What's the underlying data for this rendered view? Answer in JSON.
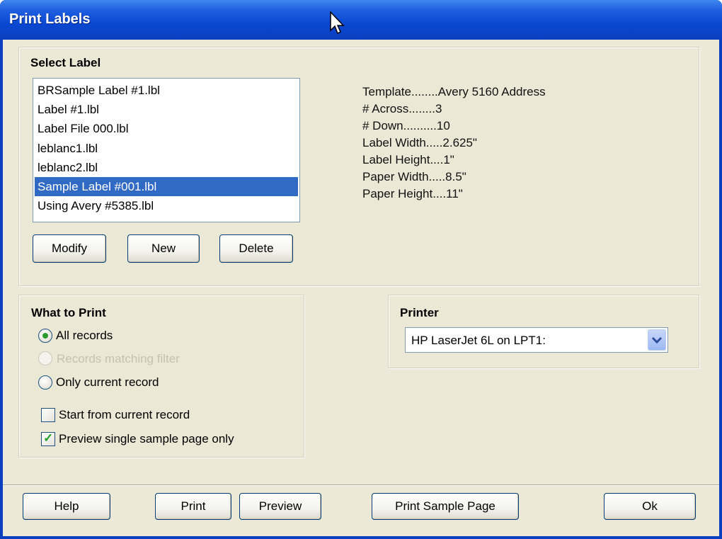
{
  "window": {
    "title": "Print Labels"
  },
  "select_label": {
    "title": "Select Label",
    "items": [
      {
        "label": "BRSample Label #1.lbl",
        "selected": false
      },
      {
        "label": "Label #1.lbl",
        "selected": false
      },
      {
        "label": "Label File 000.lbl",
        "selected": false
      },
      {
        "label": "leblanc1.lbl",
        "selected": false
      },
      {
        "label": "leblanc2.lbl",
        "selected": false
      },
      {
        "label": "Sample Label #001.lbl",
        "selected": true
      },
      {
        "label": "Using Avery #5385.lbl",
        "selected": false
      }
    ],
    "buttons": {
      "modify": "Modify",
      "new": "New",
      "delete": "Delete"
    }
  },
  "template_info": [
    "Template........Avery 5160  Address",
    "# Across........3",
    "# Down..........10",
    "Label Width.....2.625\"",
    "Label Height....1\"",
    "Paper Width.....8.5\"",
    "Paper Height....11\""
  ],
  "what_to_print": {
    "title": "What to Print",
    "all_records": "All records",
    "records_matching_filter": "Records matching filter",
    "only_current_record": "Only current record",
    "selected_option": "all_records",
    "start_from_current": {
      "label": "Start from current record",
      "checked": false
    },
    "preview_single": {
      "label": "Preview single sample page only",
      "checked": true
    }
  },
  "printer": {
    "title": "Printer",
    "selected": "HP LaserJet 6L on LPT1:"
  },
  "footer": {
    "help": "Help",
    "print": "Print",
    "preview": "Preview",
    "print_sample_page": "Print Sample Page",
    "ok": "Ok"
  },
  "icons": {
    "cursor": "mouse-pointer-icon",
    "dropdown": "chevron-down-icon"
  },
  "colors": {
    "titlebar": "#0a48d2",
    "selection": "#316ac5",
    "dialog_bg": "#ece9d8"
  }
}
